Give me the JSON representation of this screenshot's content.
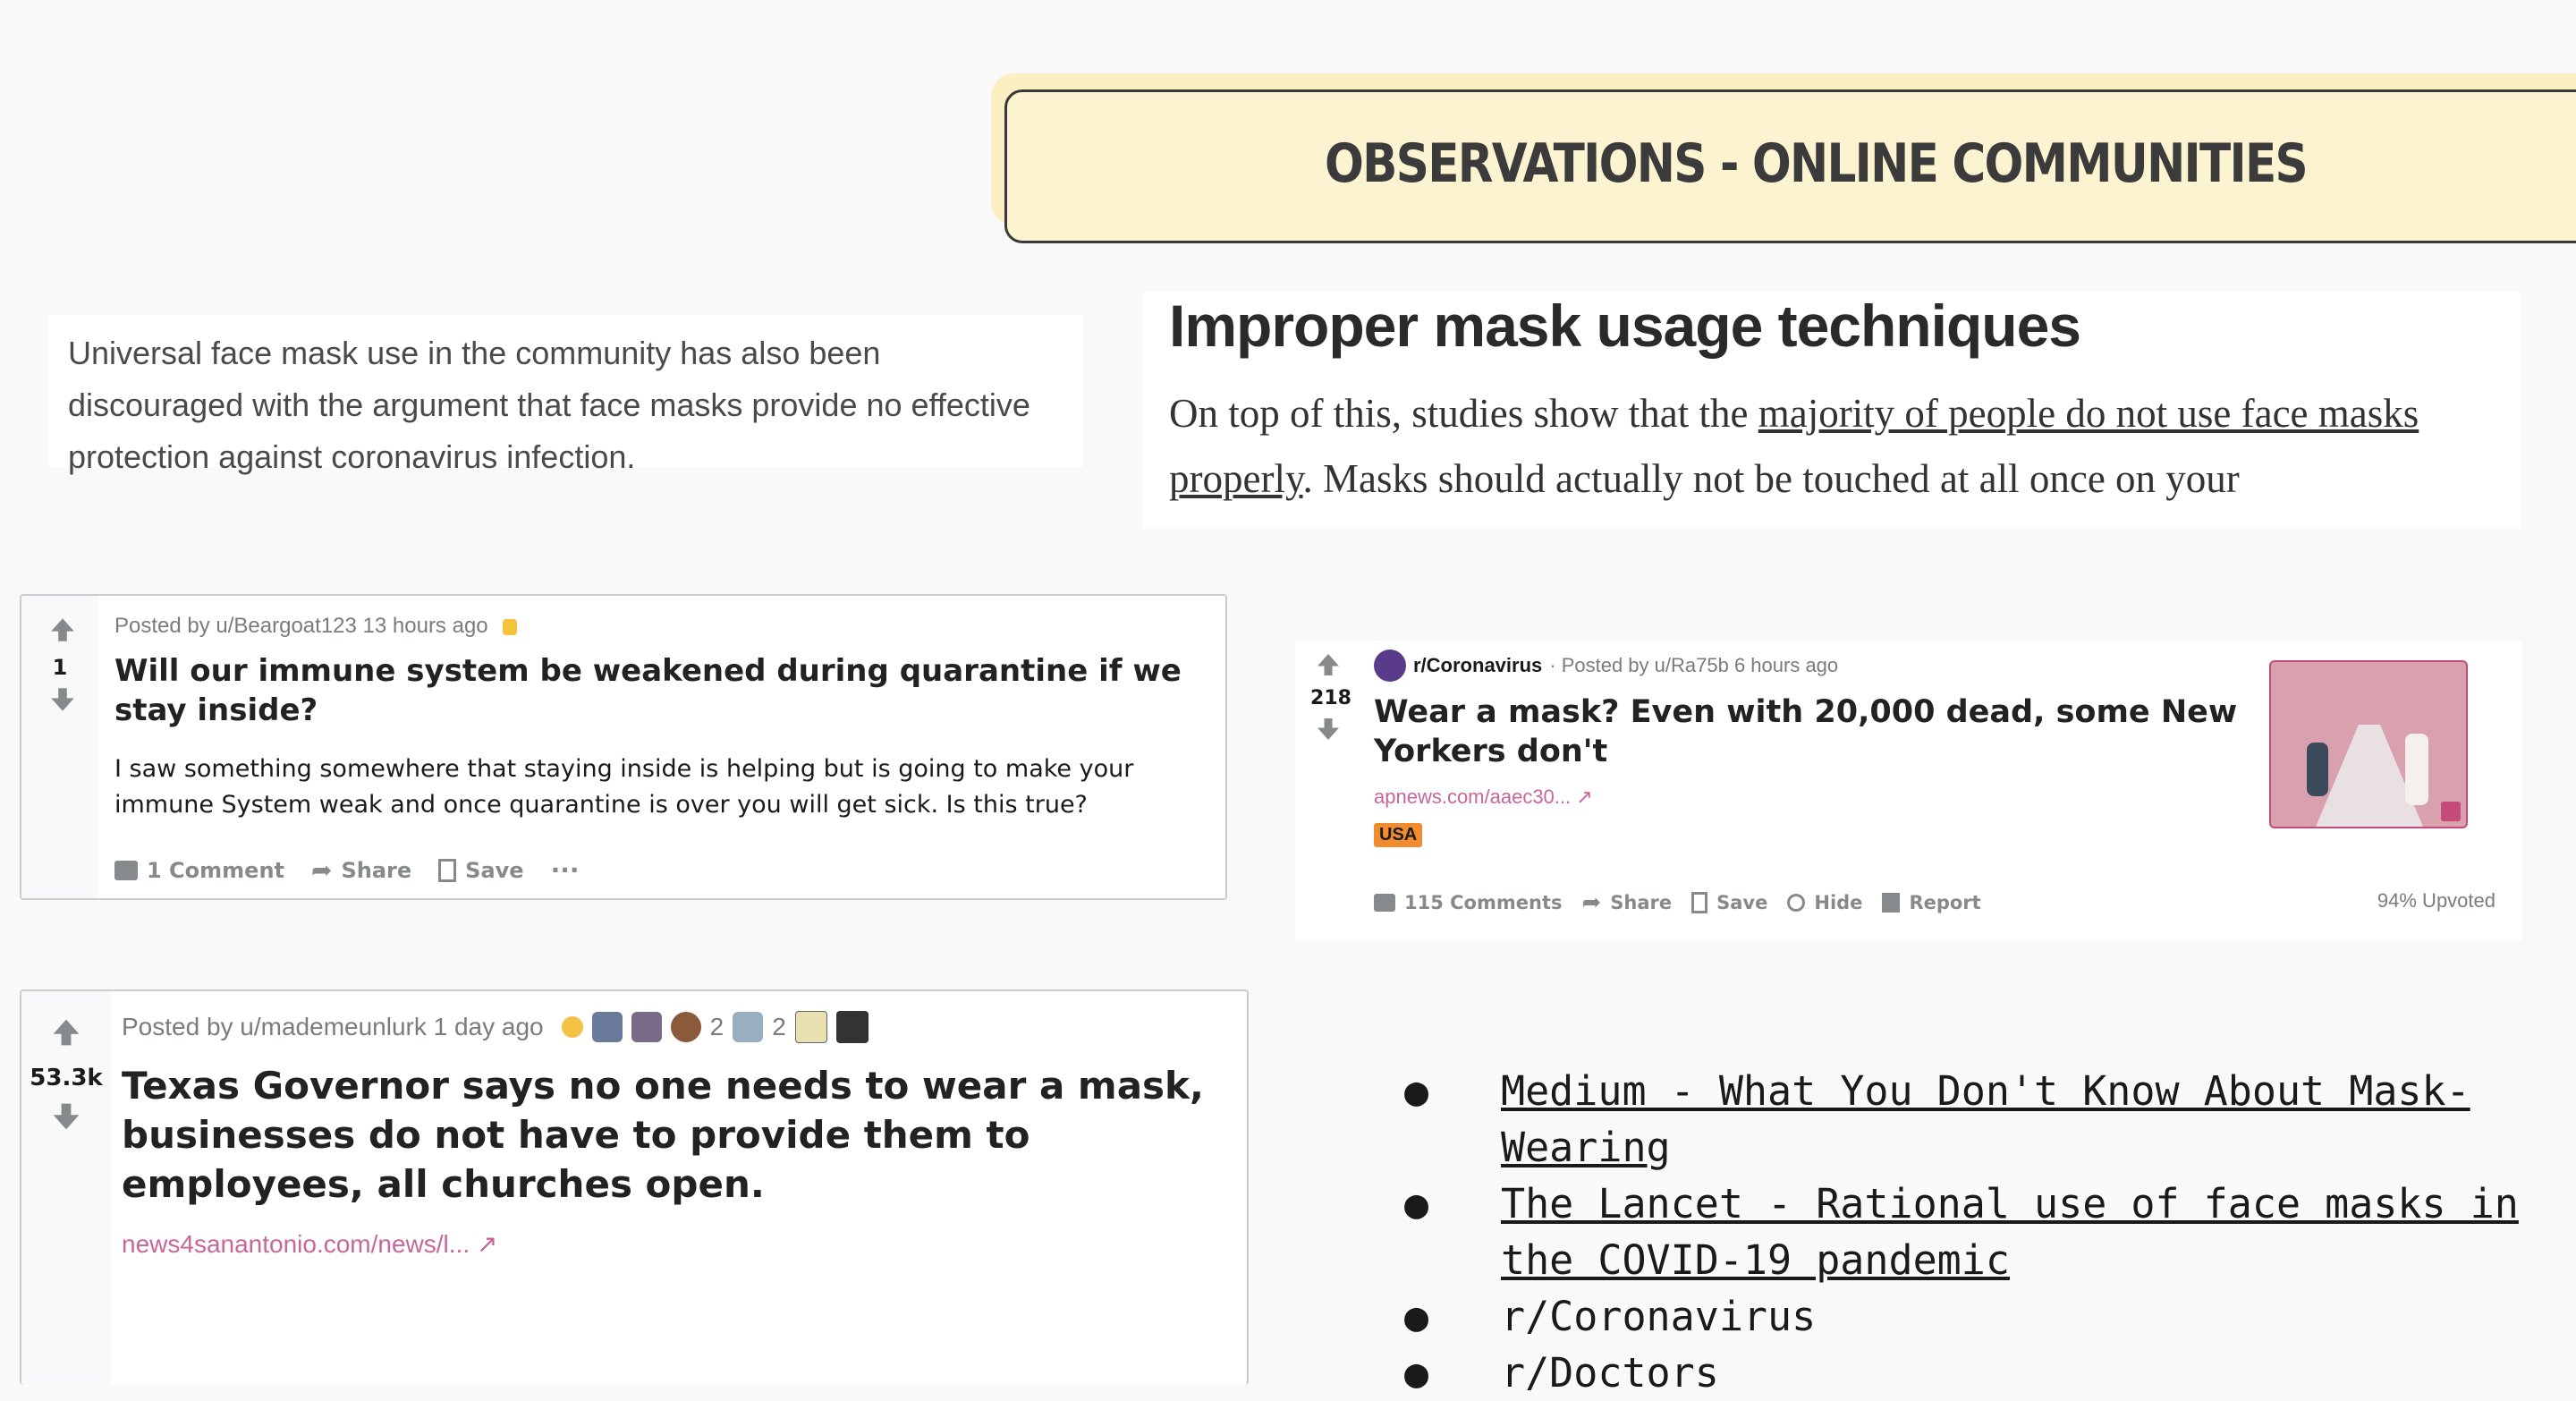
{
  "banner": {
    "title": "OBSERVATIONS - ONLINE COMMUNITIES"
  },
  "quote": {
    "text": "Universal face mask use in the community has also been discouraged with the argument that face masks provide no effective protection against coronavirus infection."
  },
  "article": {
    "heading": "Improper mask usage techniques",
    "body_start": "On top of this, studies show that the ",
    "body_link": "majority of people do not use face masks properly",
    "body_end": ". Masks should actually not be touched at all once on your"
  },
  "post1": {
    "votes": "1",
    "meta": "Posted by u/Beargoat123 13 hours ago",
    "title": "Will our immune system be weakened during quarantine if we stay inside?",
    "body": "I saw something somewhere that staying inside is helping but is going to make your immune System weak and once quarantine is over you will get sick. Is this true?",
    "comments": "1 Comment",
    "share": "Share",
    "save": "Save",
    "more": "···"
  },
  "post2": {
    "votes": "218",
    "subreddit": "r/Coronavirus",
    "meta": "· Posted by u/Ra75b 6 hours ago",
    "title": "Wear a mask? Even with 20,000 dead, some New Yorkers don't",
    "link": "apnews.com/aaec30...",
    "flair": "USA",
    "comments": "115 Comments",
    "share": "Share",
    "save": "Save",
    "hide": "Hide",
    "report": "Report",
    "upvoted": "94% Upvoted"
  },
  "post3": {
    "votes": "53.3k",
    "meta": "Posted by u/mademeunlurk 1 day ago",
    "award_count_a": "2",
    "award_count_b": "2",
    "title": "Texas Governor says no one needs to wear a mask, businesses do not have to provide them to employees, all churches open.",
    "link": "news4sanantonio.com/news/l..."
  },
  "references": [
    {
      "text": "Medium - What You Don't Know About Mask-Wearing",
      "linked": true
    },
    {
      "text": "The Lancet - Rational use of face masks in the COVID-19 pandemic",
      "linked": true
    },
    {
      "text": "r/Coronavirus",
      "linked": false
    },
    {
      "text": "r/Doctors",
      "linked": false
    }
  ],
  "bullet": "●",
  "colors": {
    "banner_bg": "#fcf3d0",
    "link_pink": "#c8669c",
    "flair_orange": "#f08c2e"
  }
}
